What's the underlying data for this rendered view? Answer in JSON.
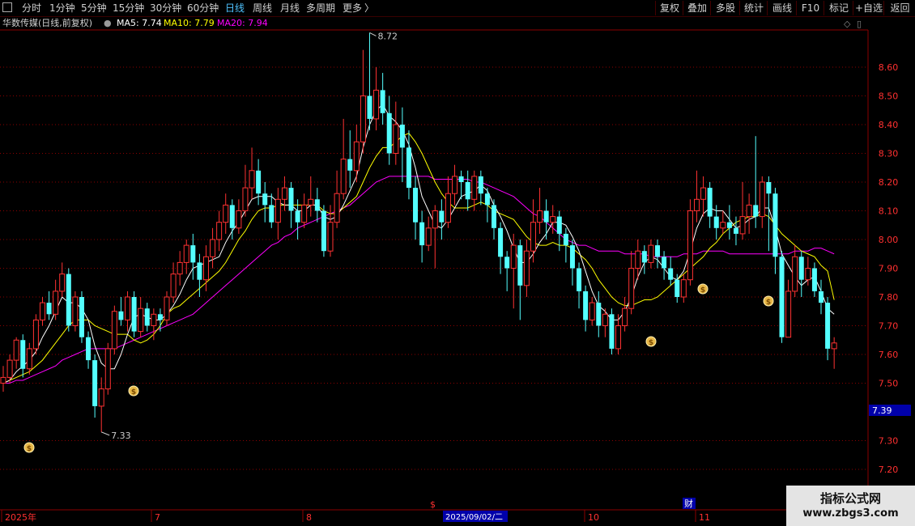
{
  "toolbar": {
    "left": [
      {
        "label": "分时",
        "active": false
      },
      {
        "label": "1分钟",
        "active": false
      },
      {
        "label": "5分钟",
        "active": false
      },
      {
        "label": "15分钟",
        "active": false
      },
      {
        "label": "30分钟",
        "active": false
      },
      {
        "label": "60分钟",
        "active": false
      },
      {
        "label": "日线",
        "active": true
      },
      {
        "label": "周线",
        "active": false
      },
      {
        "label": "月线",
        "active": false
      },
      {
        "label": "多周期",
        "active": false
      },
      {
        "label": "更多",
        "active": false
      }
    ],
    "more_arrow": "〉",
    "right": [
      "复权",
      "叠加",
      "多股",
      "统计",
      "画线",
      "F10",
      "标记",
      "+自选",
      "返回"
    ]
  },
  "info": {
    "title": "华数传媒(日线,前复权)",
    "ma5_label": "MA5: 7.74",
    "ma10_label": "MA10: 7.79",
    "ma20_label": "MA20: 7.94"
  },
  "colors": {
    "up": "#ff3232",
    "down": "#54ffff",
    "ma5": "#ffffff",
    "ma10": "#ffff00",
    "ma20": "#ff00ff",
    "grid": "#8c0000",
    "axis_text": "#ff3030",
    "date_text": "#ff3030",
    "current_price_bg": "#0000aa"
  },
  "annotations": {
    "high_label": "8.72",
    "low_label": "7.33",
    "current_price": "7.39",
    "date_cursor": "2025/09/02/二",
    "dollar_mark": "$",
    "cai_mark": "财"
  },
  "watermark": {
    "line1": "指标公式网",
    "line2": "www.zbgs3.com"
  },
  "chart_data": {
    "type": "candlestick",
    "title": "华数传媒(日线,前复权)",
    "y_ticks": [
      7.2,
      7.3,
      7.5,
      7.6,
      7.7,
      7.8,
      7.9,
      8.0,
      8.1,
      8.2,
      8.3,
      8.4,
      8.5,
      8.6
    ],
    "x_labels": [
      "2025年",
      "7",
      "8",
      "2025/09/02/二",
      "10",
      "11"
    ],
    "high": 8.72,
    "low": 7.33,
    "last": 7.39,
    "ma5_last": 7.74,
    "ma10_last": 7.79,
    "ma20_last": 7.94,
    "candles": [
      [
        7.5,
        7.52,
        7.56,
        7.47
      ],
      [
        7.52,
        7.58,
        7.6,
        7.5
      ],
      [
        7.58,
        7.65,
        7.66,
        7.55
      ],
      [
        7.65,
        7.55,
        7.67,
        7.52
      ],
      [
        7.55,
        7.62,
        7.64,
        7.53
      ],
      [
        7.62,
        7.72,
        7.74,
        7.6
      ],
      [
        7.72,
        7.78,
        7.8,
        7.7
      ],
      [
        7.78,
        7.74,
        7.82,
        7.72
      ],
      [
        7.74,
        7.82,
        7.86,
        7.72
      ],
      [
        7.82,
        7.88,
        7.92,
        7.8
      ],
      [
        7.88,
        7.7,
        7.9,
        7.68
      ],
      [
        7.7,
        7.8,
        7.82,
        7.68
      ],
      [
        7.8,
        7.66,
        7.82,
        7.64
      ],
      [
        7.66,
        7.58,
        7.68,
        7.55
      ],
      [
        7.58,
        7.42,
        7.6,
        7.38
      ],
      [
        7.42,
        7.48,
        7.52,
        7.33
      ],
      [
        7.48,
        7.62,
        7.64,
        7.46
      ],
      [
        7.62,
        7.75,
        7.77,
        7.6
      ],
      [
        7.75,
        7.72,
        7.8,
        7.7
      ],
      [
        7.72,
        7.8,
        7.82,
        7.68
      ],
      [
        7.8,
        7.68,
        7.82,
        7.66
      ],
      [
        7.68,
        7.76,
        7.8,
        7.66
      ],
      [
        7.76,
        7.7,
        7.78,
        7.68
      ],
      [
        7.7,
        7.74,
        7.76,
        7.65
      ],
      [
        7.74,
        7.72,
        7.76,
        7.68
      ],
      [
        7.72,
        7.8,
        7.82,
        7.7
      ],
      [
        7.8,
        7.88,
        7.92,
        7.78
      ],
      [
        7.88,
        7.92,
        7.96,
        7.84
      ],
      [
        7.92,
        7.98,
        8.0,
        7.88
      ],
      [
        7.98,
        7.92,
        8.02,
        7.86
      ],
      [
        7.92,
        7.86,
        7.95,
        7.8
      ],
      [
        7.86,
        7.94,
        7.98,
        7.82
      ],
      [
        7.94,
        8.0,
        8.04,
        7.9
      ],
      [
        8.0,
        8.06,
        8.1,
        7.96
      ],
      [
        8.06,
        8.12,
        8.16,
        8.02
      ],
      [
        8.12,
        8.04,
        8.14,
        8.0
      ],
      [
        8.04,
        8.1,
        8.14,
        8.02
      ],
      [
        8.1,
        8.18,
        8.26,
        8.08
      ],
      [
        8.18,
        8.24,
        8.32,
        8.14
      ],
      [
        8.24,
        8.16,
        8.28,
        8.12
      ],
      [
        8.16,
        8.12,
        8.2,
        8.06
      ],
      [
        8.12,
        8.06,
        8.16,
        8.04
      ],
      [
        8.06,
        8.14,
        8.18,
        8.0
      ],
      [
        8.14,
        8.18,
        8.22,
        8.1
      ],
      [
        8.18,
        8.1,
        8.2,
        8.04
      ],
      [
        8.1,
        8.06,
        8.14,
        8.0
      ],
      [
        8.06,
        8.12,
        8.16,
        8.04
      ],
      [
        8.12,
        8.14,
        8.22,
        8.08
      ],
      [
        8.14,
        8.1,
        8.18,
        8.06
      ],
      [
        8.1,
        7.96,
        8.12,
        7.94
      ],
      [
        7.96,
        8.06,
        8.12,
        7.94
      ],
      [
        8.06,
        8.16,
        8.24,
        8.04
      ],
      [
        8.16,
        8.28,
        8.42,
        8.14
      ],
      [
        8.28,
        8.24,
        8.38,
        8.18
      ],
      [
        8.24,
        8.34,
        8.4,
        8.2
      ],
      [
        8.34,
        8.5,
        8.66,
        8.3
      ],
      [
        8.5,
        8.42,
        8.72,
        8.38
      ],
      [
        8.42,
        8.52,
        8.6,
        8.38
      ],
      [
        8.52,
        8.44,
        8.58,
        8.4
      ],
      [
        8.44,
        8.3,
        8.5,
        8.26
      ],
      [
        8.3,
        8.4,
        8.48,
        8.26
      ],
      [
        8.4,
        8.32,
        8.46,
        8.2
      ],
      [
        8.32,
        8.18,
        8.38,
        8.14
      ],
      [
        8.18,
        8.06,
        8.22,
        8.0
      ],
      [
        8.06,
        7.98,
        8.1,
        7.92
      ],
      [
        7.98,
        8.04,
        8.08,
        7.96
      ],
      [
        8.04,
        8.1,
        8.12,
        7.9
      ],
      [
        8.1,
        8.06,
        8.14,
        8.0
      ],
      [
        8.06,
        8.16,
        8.22,
        8.04
      ],
      [
        8.16,
        8.22,
        8.26,
        8.12
      ],
      [
        8.22,
        8.2,
        8.24,
        8.14
      ],
      [
        8.2,
        8.14,
        8.24,
        8.1
      ],
      [
        8.14,
        8.22,
        8.24,
        8.1
      ],
      [
        8.22,
        8.16,
        8.24,
        8.12
      ],
      [
        8.16,
        8.12,
        8.18,
        8.06
      ],
      [
        8.12,
        8.04,
        8.14,
        8.0
      ],
      [
        8.04,
        7.94,
        8.06,
        7.88
      ],
      [
        7.94,
        7.9,
        7.96,
        7.82
      ],
      [
        7.9,
        7.98,
        8.02,
        7.76
      ],
      [
        7.98,
        7.84,
        8.0,
        7.72
      ],
      [
        7.84,
        7.96,
        8.0,
        7.8
      ],
      [
        7.96,
        8.06,
        8.14,
        7.92
      ],
      [
        8.06,
        8.1,
        8.18,
        8.02
      ],
      [
        8.1,
        8.06,
        8.14,
        8.0
      ],
      [
        8.06,
        8.08,
        8.12,
        8.02
      ],
      [
        8.08,
        8.02,
        8.1,
        7.96
      ],
      [
        8.02,
        7.98,
        8.04,
        7.92
      ],
      [
        7.98,
        7.9,
        8.0,
        7.84
      ],
      [
        7.9,
        7.82,
        7.92,
        7.76
      ],
      [
        7.82,
        7.72,
        7.84,
        7.68
      ],
      [
        7.72,
        7.78,
        7.8,
        7.7
      ],
      [
        7.78,
        7.7,
        7.82,
        7.66
      ],
      [
        7.7,
        7.74,
        7.76,
        7.66
      ],
      [
        7.74,
        7.62,
        7.76,
        7.6
      ],
      [
        7.62,
        7.7,
        7.74,
        7.6
      ],
      [
        7.7,
        7.76,
        7.8,
        7.68
      ],
      [
        7.76,
        7.9,
        7.96,
        7.74
      ],
      [
        7.9,
        7.96,
        8.0,
        7.86
      ],
      [
        7.96,
        7.92,
        7.98,
        7.88
      ],
      [
        7.92,
        7.98,
        8.0,
        7.9
      ],
      [
        7.98,
        7.94,
        8.0,
        7.9
      ],
      [
        7.94,
        7.9,
        7.96,
        7.86
      ],
      [
        7.9,
        7.86,
        7.94,
        7.84
      ],
      [
        7.86,
        7.8,
        7.88,
        7.78
      ],
      [
        7.8,
        7.86,
        7.88,
        7.78
      ],
      [
        7.86,
        8.1,
        8.14,
        7.84
      ],
      [
        8.1,
        8.14,
        8.24,
        8.06
      ],
      [
        8.14,
        8.18,
        8.22,
        8.08
      ],
      [
        8.18,
        8.08,
        8.2,
        8.04
      ],
      [
        8.08,
        8.04,
        8.12,
        8.0
      ],
      [
        8.04,
        8.06,
        8.1,
        8.02
      ],
      [
        8.06,
        8.04,
        8.12,
        8.0
      ],
      [
        8.04,
        8.02,
        8.08,
        7.98
      ],
      [
        8.02,
        8.08,
        8.2,
        8.0
      ],
      [
        8.08,
        8.12,
        8.16,
        8.02
      ],
      [
        8.12,
        8.08,
        8.36,
        8.04
      ],
      [
        8.08,
        8.2,
        8.22,
        8.04
      ],
      [
        8.2,
        8.16,
        8.22,
        7.96
      ],
      [
        8.16,
        7.94,
        8.18,
        7.88
      ],
      [
        7.94,
        7.66,
        7.96,
        7.64
      ],
      [
        7.66,
        7.82,
        7.86,
        7.68
      ],
      [
        7.82,
        7.94,
        7.98,
        7.8
      ],
      [
        7.94,
        7.86,
        7.96,
        7.8
      ],
      [
        7.86,
        7.9,
        7.94,
        7.84
      ],
      [
        7.9,
        7.82,
        7.92,
        7.8
      ],
      [
        7.82,
        7.78,
        7.86,
        7.74
      ],
      [
        7.78,
        7.62,
        7.8,
        7.58
      ],
      [
        7.62,
        7.64,
        7.66,
        7.55
      ]
    ],
    "ma5": [
      7.5,
      7.51,
      7.54,
      7.56,
      7.58,
      7.61,
      7.66,
      7.7,
      7.75,
      7.8,
      7.78,
      7.78,
      7.76,
      7.72,
      7.63,
      7.57,
      7.55,
      7.55,
      7.6,
      7.67,
      7.73,
      7.74,
      7.73,
      7.72,
      7.72,
      7.74,
      7.77,
      7.81,
      7.86,
      7.9,
      7.91,
      7.92,
      7.93,
      7.94,
      7.99,
      8.03,
      8.06,
      8.1,
      8.14,
      8.15,
      8.15,
      8.15,
      8.13,
      8.12,
      8.12,
      8.1,
      8.1,
      8.12,
      8.12,
      8.08,
      8.07,
      8.08,
      8.12,
      8.17,
      8.22,
      8.32,
      8.4,
      8.45,
      8.47,
      8.43,
      8.41,
      8.38,
      8.33,
      8.25,
      8.15,
      8.1,
      8.05,
      8.04,
      8.07,
      8.11,
      8.15,
      8.16,
      8.17,
      8.19,
      8.17,
      8.12,
      8.08,
      8.03,
      7.97,
      7.92,
      7.92,
      7.95,
      7.99,
      8.02,
      8.06,
      8.06,
      8.05,
      8.01,
      7.96,
      7.89,
      7.82,
      7.77,
      7.75,
      7.72,
      7.72,
      7.75,
      7.8,
      7.87,
      7.92,
      7.94,
      7.93,
      7.9,
      7.87,
      7.86,
      7.89,
      7.96,
      8.04,
      8.09,
      8.11,
      8.1,
      8.1,
      8.07,
      8.04,
      8.05,
      8.07,
      8.08,
      8.11,
      8.11,
      8.04,
      7.95,
      7.91,
      7.87,
      7.84,
      7.86,
      7.87,
      7.82,
      7.76,
      7.74
    ],
    "ma10": [
      7.5,
      7.51,
      7.52,
      7.53,
      7.54,
      7.56,
      7.58,
      7.61,
      7.64,
      7.67,
      7.7,
      7.72,
      7.72,
      7.72,
      7.7,
      7.69,
      7.68,
      7.67,
      7.67,
      7.67,
      7.65,
      7.64,
      7.65,
      7.67,
      7.7,
      7.74,
      7.76,
      7.77,
      7.79,
      7.81,
      7.83,
      7.85,
      7.87,
      7.89,
      7.92,
      7.96,
      8.0,
      8.03,
      8.07,
      8.1,
      8.11,
      8.11,
      8.12,
      8.12,
      8.12,
      8.12,
      8.12,
      8.12,
      8.12,
      8.1,
      8.09,
      8.09,
      8.11,
      8.13,
      8.15,
      8.2,
      8.25,
      8.29,
      8.32,
      8.32,
      8.34,
      8.36,
      8.37,
      8.34,
      8.3,
      8.25,
      8.2,
      8.16,
      8.13,
      8.11,
      8.11,
      8.11,
      8.12,
      8.13,
      8.12,
      8.1,
      8.09,
      8.08,
      8.07,
      8.04,
      8.01,
      7.99,
      7.98,
      7.98,
      7.99,
      7.98,
      7.98,
      7.97,
      7.95,
      7.93,
      7.9,
      7.86,
      7.83,
      7.8,
      7.78,
      7.77,
      7.77,
      7.78,
      7.79,
      7.79,
      7.8,
      7.82,
      7.84,
      7.86,
      7.88,
      7.9,
      7.92,
      7.94,
      7.97,
      7.99,
      8.02,
      8.04,
      8.06,
      8.07,
      8.08,
      8.08,
      8.09,
      8.08,
      8.05,
      8.02,
      8.0,
      7.98,
      7.96,
      7.95,
      7.94,
      7.91,
      7.89,
      7.79
    ],
    "ma20": [
      7.5,
      7.5,
      7.51,
      7.51,
      7.52,
      7.53,
      7.54,
      7.55,
      7.56,
      7.58,
      7.59,
      7.6,
      7.61,
      7.62,
      7.62,
      7.62,
      7.62,
      7.62,
      7.63,
      7.64,
      7.65,
      7.66,
      7.67,
      7.68,
      7.69,
      7.7,
      7.71,
      7.72,
      7.73,
      7.74,
      7.76,
      7.78,
      7.8,
      7.82,
      7.84,
      7.86,
      7.88,
      7.9,
      7.92,
      7.94,
      7.96,
      7.98,
      7.99,
      8.01,
      8.02,
      8.04,
      8.05,
      8.06,
      8.07,
      8.08,
      8.09,
      8.1,
      8.11,
      8.12,
      8.14,
      8.16,
      8.18,
      8.2,
      8.21,
      8.22,
      8.22,
      8.22,
      8.22,
      8.22,
      8.22,
      8.22,
      8.21,
      8.21,
      8.21,
      8.21,
      8.21,
      8.21,
      8.2,
      8.2,
      8.19,
      8.18,
      8.17,
      8.16,
      8.15,
      8.13,
      8.11,
      8.09,
      8.08,
      8.06,
      8.04,
      8.02,
      8.0,
      7.99,
      7.98,
      7.98,
      7.97,
      7.96,
      7.96,
      7.96,
      7.96,
      7.95,
      7.95,
      7.95,
      7.95,
      7.94,
      7.94,
      7.94,
      7.94,
      7.94,
      7.95,
      7.95,
      7.95,
      7.96,
      7.96,
      7.96,
      7.96,
      7.95,
      7.95,
      7.95,
      7.95,
      7.95,
      7.95,
      7.95,
      7.95,
      7.95,
      7.95,
      7.96,
      7.96,
      7.96,
      7.97,
      7.97,
      7.96,
      7.95
    ]
  }
}
